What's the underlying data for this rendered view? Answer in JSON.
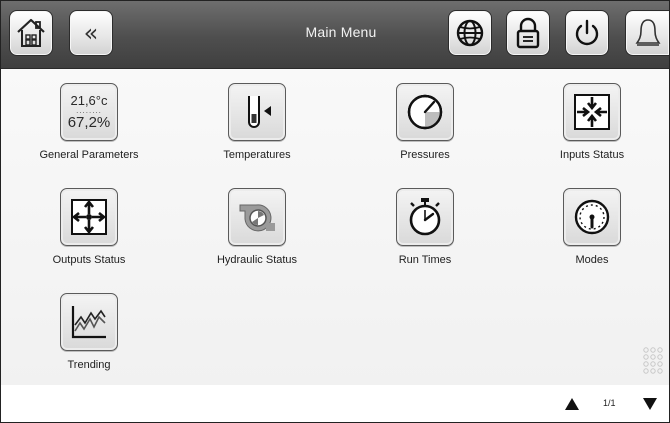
{
  "header": {
    "title": "Main Menu",
    "buttons": [
      {
        "icon": "home-icon"
      },
      {
        "icon": "back-chevron-icon",
        "glyph": "«"
      },
      {
        "icon": "globe-icon"
      },
      {
        "icon": "lock-icon"
      },
      {
        "icon": "power-icon"
      },
      {
        "icon": "bell-icon"
      }
    ]
  },
  "tiles": {
    "general_parameters": {
      "label": "General Parameters",
      "temperature": "21,6°c",
      "separator": "........",
      "humidity": "67,2%"
    },
    "temperatures": {
      "label": "Temperatures"
    },
    "pressures": {
      "label": "Pressures"
    },
    "inputs_status": {
      "label": "Inputs Status"
    },
    "outputs_status": {
      "label": "Outputs Status"
    },
    "hydraulic_status": {
      "label": "Hydraulic Status"
    },
    "run_times": {
      "label": "Run Times"
    },
    "modes": {
      "label": "Modes"
    },
    "trending": {
      "label": "Trending"
    }
  },
  "footer": {
    "page_indicator": "1/1",
    "up_icon": "triangle-up-icon",
    "down_icon": "triangle-down-icon"
  },
  "colors": {
    "header_bg": "#4e4e4e",
    "button_bg": "#e6e6e6",
    "title_text": "#f2f2f2"
  }
}
